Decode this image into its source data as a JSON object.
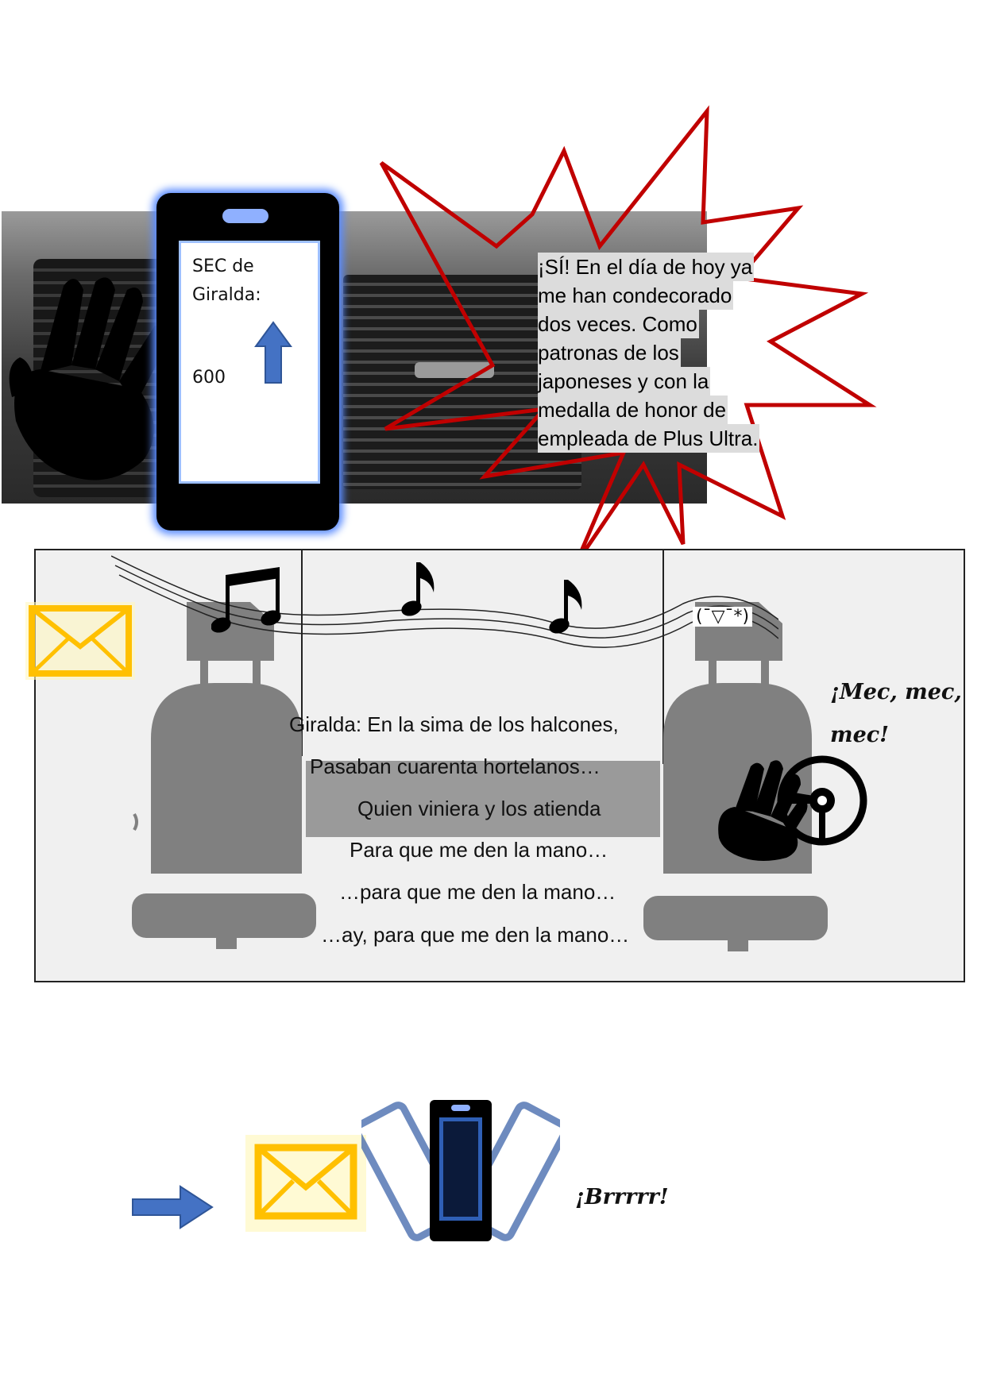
{
  "phone": {
    "app_label": "SEC de Giralda:",
    "app_label_line1": "SEC de",
    "app_label_line2": "Giralda:",
    "value": "600",
    "trend_icon": "arrow-up-icon"
  },
  "speech": {
    "lines": [
      "¡SÍ! En el día de hoy ya",
      "me han condecorado",
      "dos veces. Como",
      "patronas de los",
      "japoneses y con la",
      "medalla de honor de",
      "empleada de Plus Ultra."
    ]
  },
  "song": {
    "lines": [
      "Giralda: En la sima de los halcones,",
      "Pasaban cuarenta hortelanos…",
      "Quien viniera y los atienda",
      "Para que me den la mano…",
      "…para que me den la mano…",
      "…ay, para que me den la mano…"
    ]
  },
  "kaomoji": "(¯▽¯*)",
  "driver_sound": "¡Mec, mec, mec!",
  "driver_sound_line1": "¡Mec, mec,",
  "driver_sound_line2": "mec!",
  "vibration_sound": "¡Brrrrr!",
  "colors": {
    "phone_glow": "#5b8cff",
    "arrow_blue": "#4472c4",
    "envelope_yellow": "#ffd400",
    "speech_outline": "#c00000",
    "seat_gray": "#808080"
  }
}
